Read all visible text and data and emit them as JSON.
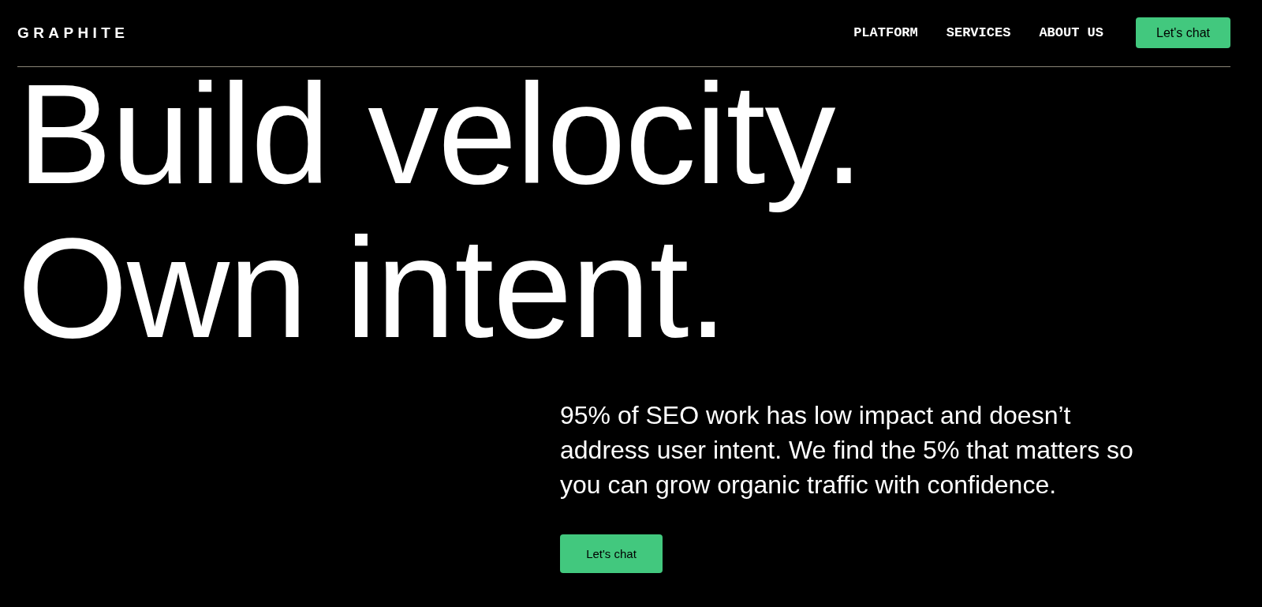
{
  "header": {
    "logo": "GRAPHITE",
    "nav": [
      {
        "label": "PLATFORM"
      },
      {
        "label": "SERVICES"
      },
      {
        "label": "ABOUT US"
      }
    ],
    "cta": "Let's chat"
  },
  "hero": {
    "headline": [
      "Build velocity.",
      "Own intent."
    ],
    "description": "95% of SEO work has low impact and doesn’t address user intent. We find the 5% that matters so you can grow organic traffic with confidence.",
    "cta": "Let's chat"
  }
}
